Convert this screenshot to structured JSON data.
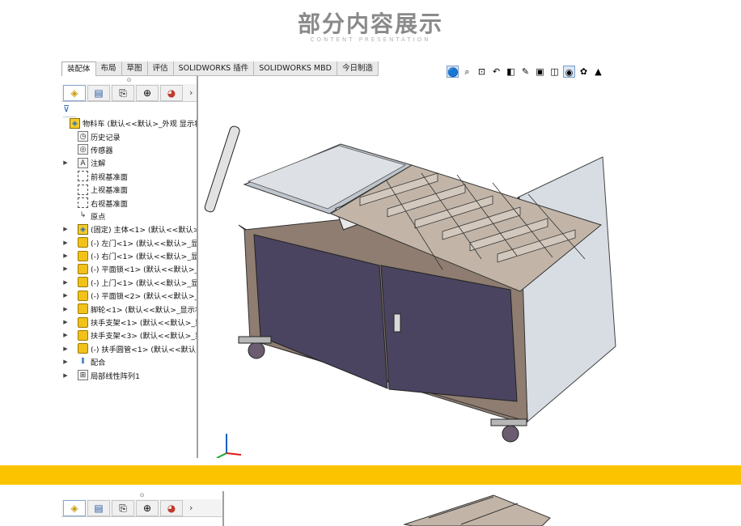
{
  "header": {
    "title": "部分内容展示",
    "subtitle": "CONTENT PRESENTATION"
  },
  "toolbar": {
    "tabs": [
      "装配体",
      "布局",
      "草图",
      "评估",
      "SOLIDWORKS 插件",
      "SOLIDWORKS MBD",
      "今日制造"
    ],
    "active_tab": "装配体"
  },
  "heads_up_toolbar": {
    "icons": [
      "view-orientation-icon",
      "zoom-to-fit-icon",
      "zoom-area-icon",
      "previous-view-icon",
      "section-view-icon",
      "dynamic-annotation-icon",
      "view-style-icon",
      "display-style-icon",
      "hide-show-icon",
      "appearance-icon",
      "scene-icon"
    ]
  },
  "feature_tree": {
    "panel_tabs": [
      "featuremanager-icon",
      "propertymanager-icon",
      "configurationmanager-icon",
      "dimxpert-icon",
      "display-manager-icon"
    ],
    "items": [
      {
        "label": "物料车 (默认<<默认>_外观 显示状态-",
        "icon": "assembly-icon",
        "expander": ""
      },
      {
        "label": "历史记录",
        "icon": "history-icon",
        "expander": ""
      },
      {
        "label": "传感器",
        "icon": "sensor-icon",
        "expander": ""
      },
      {
        "label": "注解",
        "icon": "annotation-icon",
        "expander": "▶"
      },
      {
        "label": "前视基准面",
        "icon": "plane-icon",
        "expander": ""
      },
      {
        "label": "上视基准面",
        "icon": "plane-icon",
        "expander": ""
      },
      {
        "label": "右视基准面",
        "icon": "plane-icon",
        "expander": ""
      },
      {
        "label": "原点",
        "icon": "origin-icon",
        "expander": ""
      },
      {
        "label": "(固定) 主体<1> (默认<<默认>_外",
        "icon": "subassembly-icon",
        "expander": "▶"
      },
      {
        "label": "(-) 左门<1> (默认<<默认>_显示状",
        "icon": "part-icon",
        "expander": "▶"
      },
      {
        "label": "(-) 右门<1> (默认<<默认>_显示状",
        "icon": "part-icon",
        "expander": "▶"
      },
      {
        "label": "(-) 平面锁<1> (默认<<默认>_显示",
        "icon": "part-icon",
        "expander": "▶"
      },
      {
        "label": "(-) 上门<1> (默认<<默认>_显示状",
        "icon": "part-icon",
        "expander": "▶"
      },
      {
        "label": "(-) 平面锁<2> (默认<<默认>_显示",
        "icon": "part-icon",
        "expander": "▶"
      },
      {
        "label": "脚轮<1> (默认<<默认>_显示状态",
        "icon": "part-icon",
        "expander": "▶"
      },
      {
        "label": "扶手支架<1> (默认<<默认>_显示",
        "icon": "part-icon",
        "expander": "▶"
      },
      {
        "label": "扶手支架<3> (默认<<默认>_显示",
        "icon": "part-icon",
        "expander": "▶"
      },
      {
        "label": "(-) 扶手圆管<1> (默认<<默认>_显",
        "icon": "part-icon",
        "expander": "▶"
      },
      {
        "label": "配合",
        "icon": "mates-icon",
        "expander": "▶"
      },
      {
        "label": "局部线性阵列1",
        "icon": "linear-pattern-icon",
        "expander": "▶"
      }
    ]
  },
  "colors": {
    "accent_band": "#fcc400",
    "cabinet_frame": "#8e7d70",
    "door_panel": "#4a4460",
    "bin_fill": "#c2b5a8",
    "header_gray": "#8a8a8a"
  }
}
